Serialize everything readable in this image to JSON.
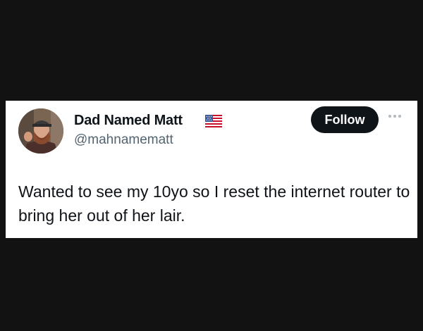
{
  "tweet": {
    "author": {
      "display_name": "Dad Named Matt",
      "handle": "@mahnamematt",
      "badge_icon": "us-flag-icon",
      "avatar_icon": "profile-photo"
    },
    "follow_label": "Follow",
    "more_icon": "more-dots-icon",
    "text": "Wanted to see my 10yo so I reset the internet router to bring her out of her lair."
  },
  "colors": {
    "page_background": "#121212",
    "card_background": "#ffffff",
    "text_primary": "#0f1419",
    "text_secondary": "#536471",
    "button_background": "#0f1419",
    "button_text": "#ffffff"
  }
}
